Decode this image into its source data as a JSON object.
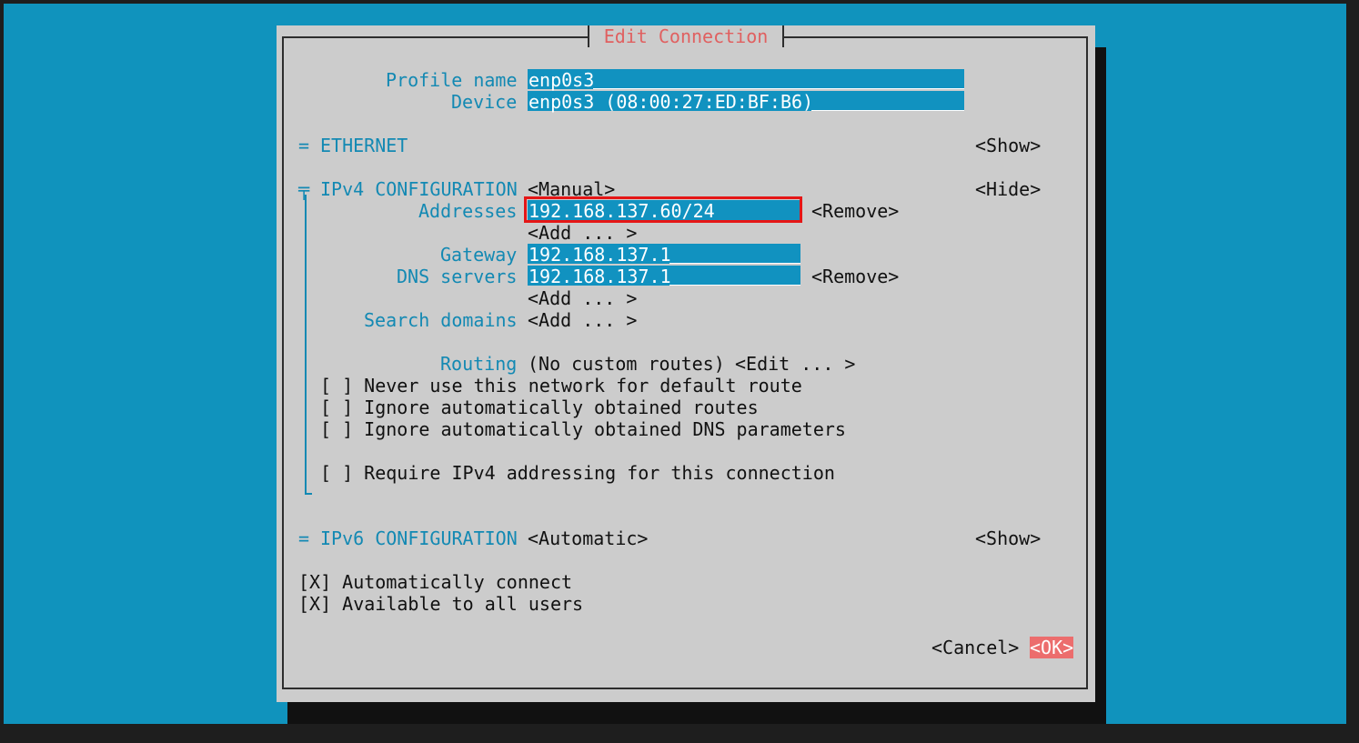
{
  "dialog": {
    "title": "Edit Connection",
    "profile_name_label": "Profile name",
    "profile_name_value": "enp0s3",
    "device_label": "Device",
    "device_value": "enp0s3 (08:00:27:ED:BF:B6)",
    "ethernet": {
      "marker": "=",
      "label": "ETHERNET",
      "toggle": "<Show>"
    },
    "ipv4": {
      "marker": "╤",
      "label": "IPv4 CONFIGURATION",
      "mode": "<Manual>",
      "toggle": "<Hide>",
      "addresses_label": "Addresses",
      "address_value": "192.168.137.60/24",
      "remove_label": "<Remove>",
      "add_label": "<Add ... >",
      "gateway_label": "Gateway",
      "gateway_value": "192.168.137.1",
      "dns_label": "DNS servers",
      "dns_value": "192.168.137.1",
      "search_domains_label": "Search domains",
      "routing_label": "Routing",
      "routing_value": "(No custom routes)",
      "routing_edit": "<Edit ... >",
      "never_default": "[ ] Never use this network for default route",
      "ignore_routes": "[ ] Ignore automatically obtained routes",
      "ignore_dns": "[ ] Ignore automatically obtained DNS parameters",
      "require_ipv4": "[ ] Require IPv4 addressing for this connection"
    },
    "ipv6": {
      "marker": "=",
      "label": "IPv6 CONFIGURATION",
      "mode": "<Automatic>",
      "toggle": "<Show>"
    },
    "auto_connect": "[X] Automatically connect",
    "all_users": "[X] Available to all users",
    "cancel_label": "<Cancel>",
    "ok_label": "<OK>"
  },
  "colors": {
    "background": "#1093bd",
    "dialog": "#cccccc",
    "accent_label": "#1389b3",
    "field": "#1192c0",
    "ok": "#ec6d6d",
    "title": "#e06060",
    "highlight": "#e51616"
  }
}
